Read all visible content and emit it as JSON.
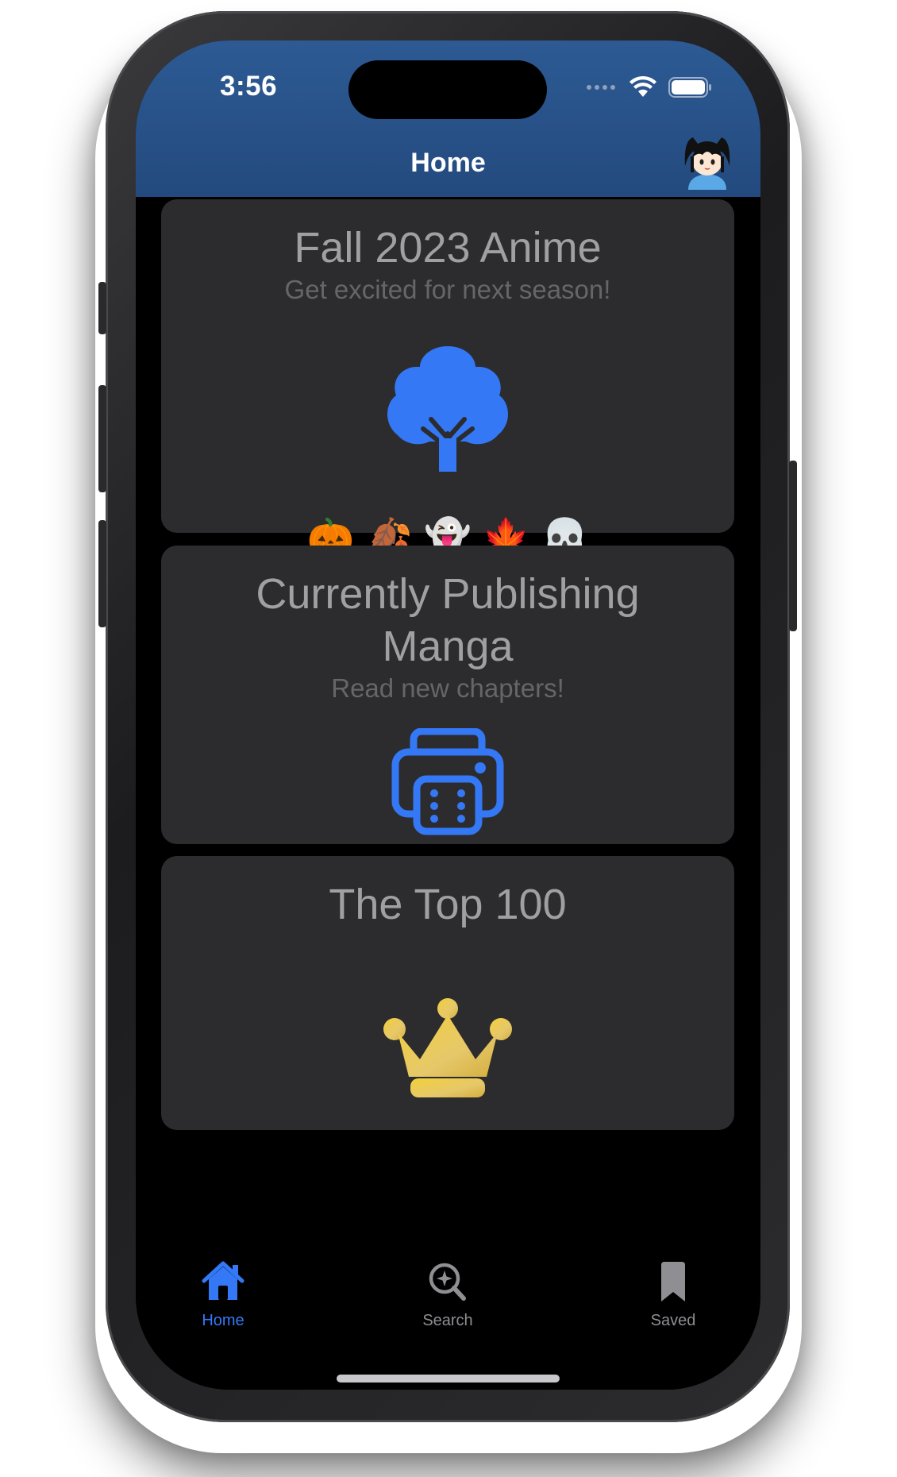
{
  "status_bar": {
    "time": "3:56",
    "icons": [
      "cellular-icon",
      "wifi-icon",
      "battery-icon"
    ]
  },
  "nav": {
    "title": "Home",
    "avatar_icon": "profile-avatar"
  },
  "cards": [
    {
      "title": "Fall 2023 Anime",
      "subtitle": "Get excited for next season!",
      "icon": "tree-icon",
      "emojis": [
        "🎃",
        "🍂",
        "👻",
        "🍁",
        "💀"
      ]
    },
    {
      "title_line1": "Currently Publishing",
      "title_line2": "Manga",
      "subtitle": "Read new chapters!",
      "icon": "printer-icon"
    },
    {
      "title": "The Top 100",
      "icon": "crown-icon"
    }
  ],
  "tabs": [
    {
      "label": "Home",
      "icon": "house-icon",
      "selected": true
    },
    {
      "label": "Search",
      "icon": "magnifier-sparkle-icon",
      "selected": false
    },
    {
      "label": "Saved",
      "icon": "bookmark-icon",
      "selected": false
    }
  ],
  "colors": {
    "accent": "#3478f6",
    "nav_background": "#2a5389",
    "card_background": "#2c2c2e",
    "inactive_tab": "#8e8e93",
    "crown_gold": "#e8c547"
  }
}
